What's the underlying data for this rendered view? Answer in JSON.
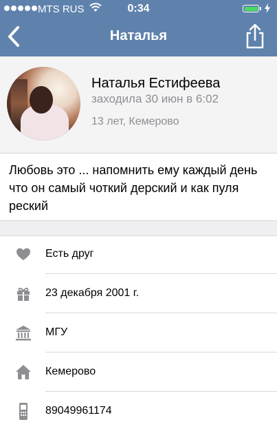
{
  "status_bar": {
    "carrier": "MTS RUS",
    "time": "0:34"
  },
  "nav": {
    "title": "Наталья",
    "back_icon": "chevron-left-icon",
    "share_icon": "share-icon"
  },
  "profile": {
    "name": "Наталья Естифеева",
    "last_seen": "заходила 30 июн в 6:02",
    "age_city": "13 лет, Кемерово"
  },
  "status_text": "Любовь это ...  напомнить ему каждый день  что он самый чоткий дерский и как пуля реский",
  "info": [
    {
      "icon": "heart-icon",
      "label": "Есть друг"
    },
    {
      "icon": "gift-icon",
      "label": "23 декабря 2001 г."
    },
    {
      "icon": "university-icon",
      "label": "МГУ"
    },
    {
      "icon": "home-icon",
      "label": "Кемерово"
    },
    {
      "icon": "phone-icon",
      "label": "89049961174"
    }
  ],
  "colors": {
    "header": "#5f82ad",
    "battery": "#4cd964",
    "muted_text": "#8e8e93",
    "icon": "#8e8e93"
  }
}
